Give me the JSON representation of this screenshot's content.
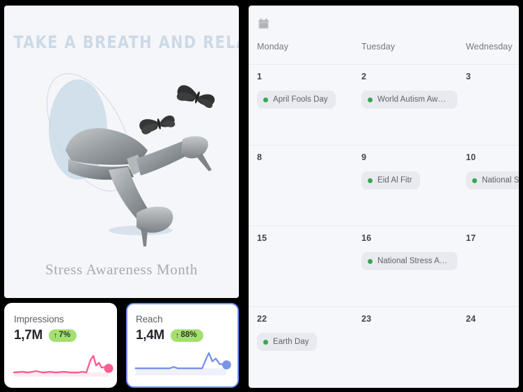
{
  "poster": {
    "title": "TAKE A BREATH AND RELAX",
    "subtitle": "Stress Awareness Month",
    "artwork_name": "legs-heels-butterflies-collage",
    "background_color": "#f5f6fa",
    "title_color": "#ccd9e6",
    "accent_blue": "#c3d5e5"
  },
  "stats": {
    "cards": [
      {
        "label": "Impressions",
        "value": "1,7M",
        "delta": "7%",
        "delta_arrow": "↑",
        "delta_color": "#a3e070",
        "line_color": "#ff5c93",
        "selected": false
      },
      {
        "label": "Reach",
        "value": "1,4M",
        "delta": "88%",
        "delta_arrow": "↑",
        "delta_color": "#a3e070",
        "line_color": "#7b93e8",
        "selected": true
      }
    ]
  },
  "calendar": {
    "toolbar": {
      "icon": "calendar-icon"
    },
    "weekdays": [
      "Monday",
      "Tuesday",
      "Wednesday"
    ],
    "event_dot_color": "#34a853",
    "chip_background": "#e9eaf0",
    "weeks": [
      {
        "days": [
          {
            "number": "1",
            "events": [
              {
                "label": "April Fools Day"
              }
            ]
          },
          {
            "number": "2",
            "events": [
              {
                "label": "World Autism Awar…"
              }
            ]
          },
          {
            "number": "3",
            "events": []
          }
        ]
      },
      {
        "days": [
          {
            "number": "8",
            "events": []
          },
          {
            "number": "9",
            "events": [
              {
                "label": "Eid Al Fitr"
              }
            ]
          },
          {
            "number": "10",
            "events": [
              {
                "label": "National Sib…"
              }
            ]
          }
        ]
      },
      {
        "days": [
          {
            "number": "15",
            "events": []
          },
          {
            "number": "16",
            "events": [
              {
                "label": "National Stress Aw…"
              }
            ]
          },
          {
            "number": "17",
            "events": []
          }
        ]
      },
      {
        "days": [
          {
            "number": "22",
            "events": [
              {
                "label": "Earth Day"
              }
            ]
          },
          {
            "number": "23",
            "events": []
          },
          {
            "number": "24",
            "events": []
          }
        ]
      }
    ]
  }
}
